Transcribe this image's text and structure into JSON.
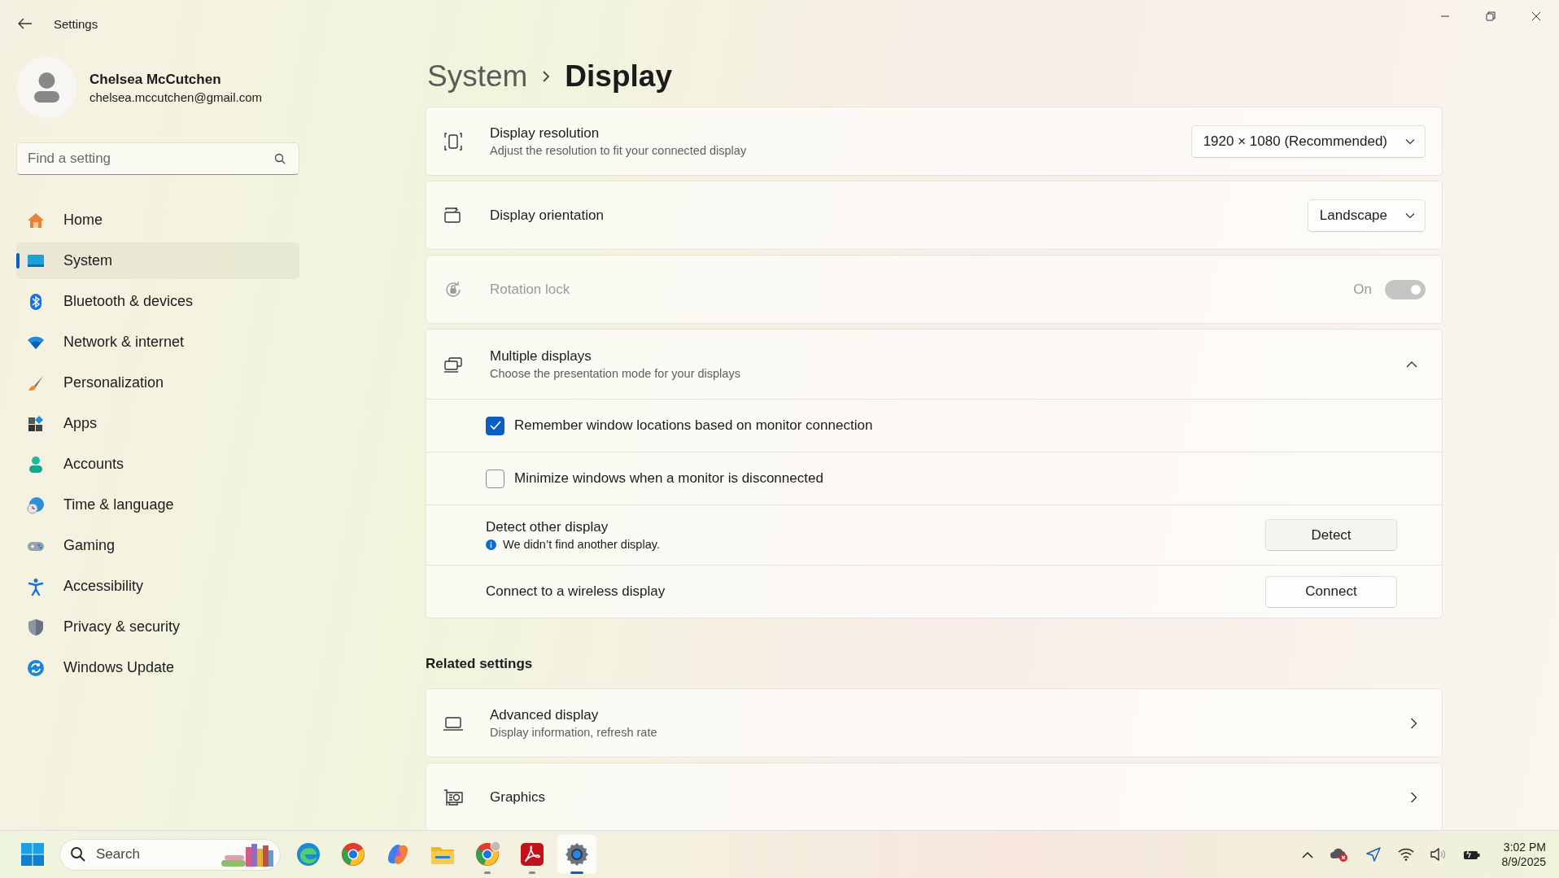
{
  "window": {
    "title": "Settings"
  },
  "account": {
    "name": "Chelsea McCutchen",
    "email": "chelsea.mccutchen@gmail.com"
  },
  "search": {
    "placeholder": "Find a setting"
  },
  "sidebar": {
    "items": [
      {
        "label": "Home",
        "selected": false
      },
      {
        "label": "System",
        "selected": true
      },
      {
        "label": "Bluetooth & devices",
        "selected": false
      },
      {
        "label": "Network & internet",
        "selected": false
      },
      {
        "label": "Personalization",
        "selected": false
      },
      {
        "label": "Apps",
        "selected": false
      },
      {
        "label": "Accounts",
        "selected": false
      },
      {
        "label": "Time & language",
        "selected": false
      },
      {
        "label": "Gaming",
        "selected": false
      },
      {
        "label": "Accessibility",
        "selected": false
      },
      {
        "label": "Privacy & security",
        "selected": false
      },
      {
        "label": "Windows Update",
        "selected": false
      }
    ]
  },
  "breadcrumb": [
    "System",
    "Display"
  ],
  "settings": [
    {
      "kind": "dropdown",
      "title": "Display resolution",
      "subtitle": "Adjust the resolution to fit your connected display",
      "value": "1920 × 1080 (Recommended)"
    },
    {
      "kind": "dropdown",
      "title": "Display orientation",
      "value": "Landscape"
    },
    {
      "kind": "toggle",
      "title": "Rotation lock",
      "state_label": "On",
      "on": true,
      "disabled": true
    },
    {
      "kind": "expander",
      "title": "Multiple displays",
      "subtitle": "Choose the presentation mode for your displays",
      "expanded": true,
      "children": [
        {
          "kind": "checkbox",
          "label": "Remember window locations based on monitor connection",
          "checked": true
        },
        {
          "kind": "checkbox",
          "label": "Minimize windows when a monitor is disconnected",
          "checked": false
        },
        {
          "kind": "button",
          "title": "Detect other display",
          "note": "We didn’t find another display.",
          "button": "Detect"
        },
        {
          "kind": "button",
          "title": "Connect to a wireless display",
          "button": "Connect"
        }
      ]
    }
  ],
  "related": {
    "heading": "Related settings",
    "items": [
      {
        "title": "Advanced display",
        "subtitle": "Display information, refresh rate"
      },
      {
        "title": "Graphics"
      }
    ]
  },
  "taskbar": {
    "search_placeholder": "Search",
    "apps": [
      {
        "running": false,
        "active": false
      },
      {
        "running": false,
        "active": false
      },
      {
        "running": false,
        "active": false
      },
      {
        "running": false,
        "active": false
      },
      {
        "running": true,
        "active": false
      },
      {
        "running": true,
        "active": false
      },
      {
        "running": true,
        "active": true
      }
    ],
    "clock": {
      "time": "3:02 PM",
      "date": "8/9/2025"
    }
  }
}
